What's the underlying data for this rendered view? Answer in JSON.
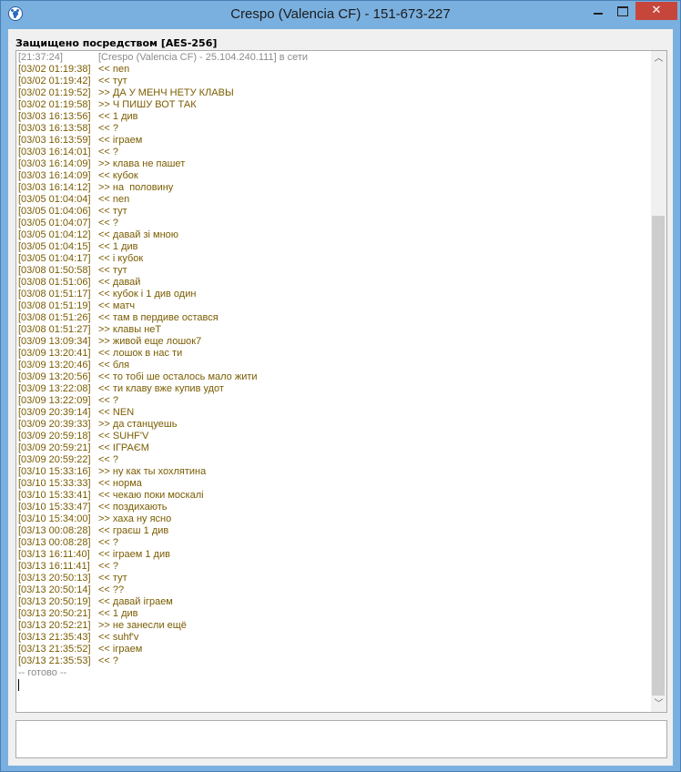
{
  "window": {
    "title": "Crespo (Valencia CF) - 151-673-227",
    "close_glyph": "✕"
  },
  "security_label": "Защищено посредством [AES-256]",
  "system_line": {
    "ts": "[21:37:24]",
    "text": "[Crespo (Valencia CF) - 25.104.240.111] в сети"
  },
  "messages": [
    {
      "ts": "[03/02 01:19:38]",
      "dir": "<<",
      "text": "nen"
    },
    {
      "ts": "[03/02 01:19:42]",
      "dir": "<<",
      "text": "тут"
    },
    {
      "ts": "[03/02 01:19:52]",
      "dir": ">>",
      "text": "ДА У МЕНЧ НЕТУ КЛАВЫ"
    },
    {
      "ts": "[03/02 01:19:58]",
      "dir": ">>",
      "text": "Ч ПИШУ ВОТ ТАК"
    },
    {
      "ts": "[03/03 16:13:56]",
      "dir": "<<",
      "text": "1 див"
    },
    {
      "ts": "[03/03 16:13:58]",
      "dir": "<<",
      "text": "?"
    },
    {
      "ts": "[03/03 16:13:59]",
      "dir": "<<",
      "text": "іграем"
    },
    {
      "ts": "[03/03 16:14:01]",
      "dir": "<<",
      "text": "?"
    },
    {
      "ts": "[03/03 16:14:09]",
      "dir": ">>",
      "text": "клава не пашет"
    },
    {
      "ts": "[03/03 16:14:09]",
      "dir": "<<",
      "text": "кубок"
    },
    {
      "ts": "[03/03 16:14:12]",
      "dir": ">>",
      "text": "на  половину"
    },
    {
      "ts": "[03/05 01:04:04]",
      "dir": "<<",
      "text": "nen"
    },
    {
      "ts": "[03/05 01:04:06]",
      "dir": "<<",
      "text": "тут"
    },
    {
      "ts": "[03/05 01:04:07]",
      "dir": "<<",
      "text": "?"
    },
    {
      "ts": "[03/05 01:04:12]",
      "dir": "<<",
      "text": "давай зі мною"
    },
    {
      "ts": "[03/05 01:04:15]",
      "dir": "<<",
      "text": "1 див"
    },
    {
      "ts": "[03/05 01:04:17]",
      "dir": "<<",
      "text": "і кубок"
    },
    {
      "ts": "[03/08 01:50:58]",
      "dir": "<<",
      "text": "тут"
    },
    {
      "ts": "[03/08 01:51:06]",
      "dir": "<<",
      "text": "давай"
    },
    {
      "ts": "[03/08 01:51:17]",
      "dir": "<<",
      "text": "кубок і 1 див один"
    },
    {
      "ts": "[03/08 01:51:19]",
      "dir": "<<",
      "text": "матч"
    },
    {
      "ts": "[03/08 01:51:26]",
      "dir": "<<",
      "text": "там в пердиве остався"
    },
    {
      "ts": "[03/08 01:51:27]",
      "dir": ">>",
      "text": "клавы неТ"
    },
    {
      "ts": "[03/09 13:09:34]",
      "dir": ">>",
      "text": "живой еще лошок7"
    },
    {
      "ts": "[03/09 13:20:41]",
      "dir": "<<",
      "text": "лошок в нас ти"
    },
    {
      "ts": "[03/09 13:20:46]",
      "dir": "<<",
      "text": "бля"
    },
    {
      "ts": "[03/09 13:20:56]",
      "dir": "<<",
      "text": "то тобі ше осталось мало жити"
    },
    {
      "ts": "[03/09 13:22:08]",
      "dir": "<<",
      "text": "ти клаву вже купив удот"
    },
    {
      "ts": "[03/09 13:22:09]",
      "dir": "<<",
      "text": "?"
    },
    {
      "ts": "[03/09 20:39:14]",
      "dir": "<<",
      "text": "NEN"
    },
    {
      "ts": "[03/09 20:39:33]",
      "dir": ">>",
      "text": "да станцуешь"
    },
    {
      "ts": "[03/09 20:59:18]",
      "dir": "<<",
      "text": "SUHF'V"
    },
    {
      "ts": "[03/09 20:59:21]",
      "dir": "<<",
      "text": "ІГРАЄМ"
    },
    {
      "ts": "[03/09 20:59:22]",
      "dir": "<<",
      "text": "?"
    },
    {
      "ts": "[03/10 15:33:16]",
      "dir": ">>",
      "text": "ну как ты хохлятина"
    },
    {
      "ts": "[03/10 15:33:33]",
      "dir": "<<",
      "text": "норма"
    },
    {
      "ts": "[03/10 15:33:41]",
      "dir": "<<",
      "text": "чекаю поки москалі"
    },
    {
      "ts": "[03/10 15:33:47]",
      "dir": "<<",
      "text": "поздихають"
    },
    {
      "ts": "[03/10 15:34:00]",
      "dir": ">>",
      "text": "хаха ну ясно"
    },
    {
      "ts": "[03/13 00:08:28]",
      "dir": "<<",
      "text": "граєш 1 див"
    },
    {
      "ts": "[03/13 00:08:28]",
      "dir": "<<",
      "text": "?"
    },
    {
      "ts": "[03/13 16:11:40]",
      "dir": "<<",
      "text": "іграем 1 див"
    },
    {
      "ts": "[03/13 16:11:41]",
      "dir": "<<",
      "text": "?"
    },
    {
      "ts": "[03/13 20:50:13]",
      "dir": "<<",
      "text": "тут"
    },
    {
      "ts": "[03/13 20:50:14]",
      "dir": "<<",
      "text": "??"
    },
    {
      "ts": "[03/13 20:50:19]",
      "dir": "<<",
      "text": "давай іграем"
    },
    {
      "ts": "[03/13 20:50:21]",
      "dir": "<<",
      "text": "1 див"
    },
    {
      "ts": "[03/13 20:52:21]",
      "dir": ">>",
      "text": "не занесли ещё"
    },
    {
      "ts": "[03/13 21:35:43]",
      "dir": "<<",
      "text": "suhf'v"
    },
    {
      "ts": "[03/13 21:35:52]",
      "dir": "<<",
      "text": "іграем"
    },
    {
      "ts": "[03/13 21:35:53]",
      "dir": "<<",
      "text": "?"
    }
  ],
  "status_text": "-- готово --",
  "scrollbar": {
    "up_glyph": "︿",
    "down_glyph": "﹀"
  },
  "input": {
    "value": ""
  },
  "colors": {
    "message_text": "#7a5c00",
    "system_text": "#8c8c8c",
    "close_button": "#c7463c",
    "frame": "#7ab0df"
  }
}
